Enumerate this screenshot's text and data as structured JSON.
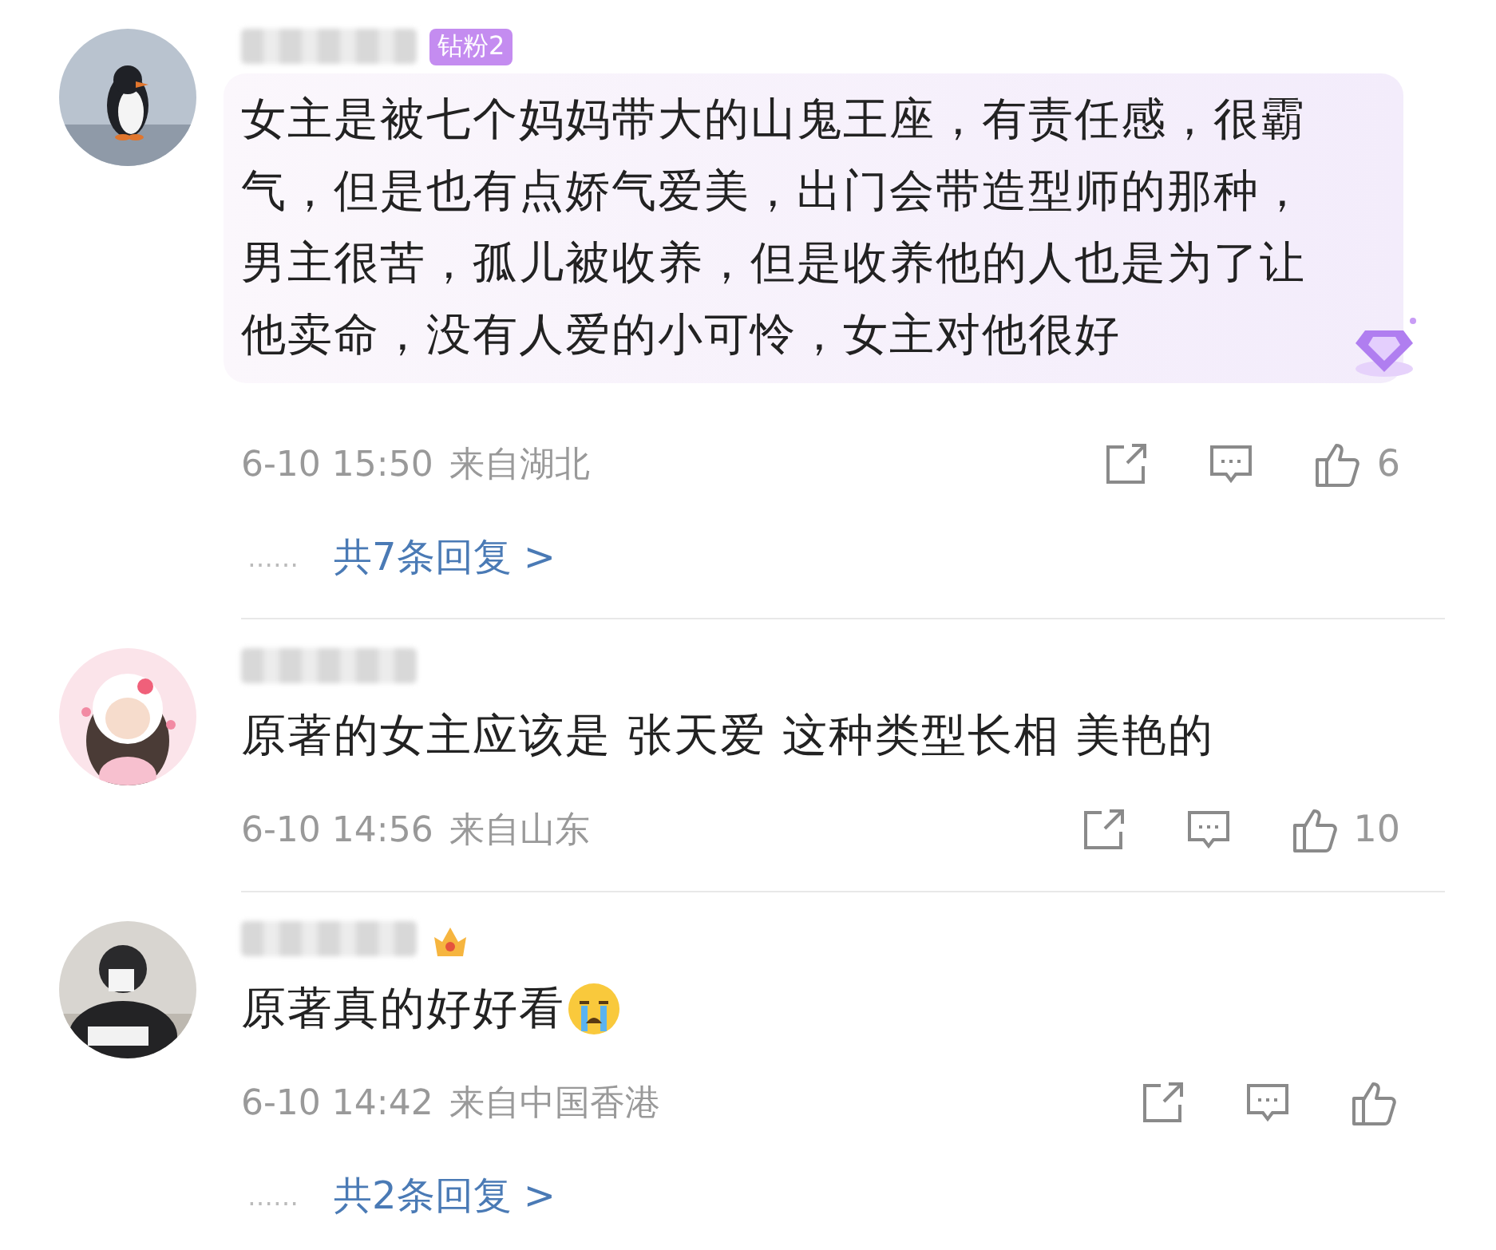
{
  "comments": [
    {
      "badge": "钻粉2",
      "text": "女主是被七个妈妈带大的山鬼王座，有责任感，很霸气，但是也有点娇气爱美，出门会带造型师的那种，男主很苦，孤儿被收养，但是收养他的人也是为了让他卖命，没有人爱的小可怜，女主对他很好",
      "highlighted": true,
      "time": "6-10 15:50",
      "location": "来自湖北",
      "likes": "6",
      "reply_dots": "……",
      "replies": "共7条回复 >"
    },
    {
      "text": "原著的女主应该是 张天爱 这种类型长相 美艳的",
      "time": "6-10 14:56",
      "location": "来自山东",
      "likes": "10"
    },
    {
      "vip": true,
      "text": "原著真的好好看",
      "crying_emoji": true,
      "time": "6-10 14:42",
      "location": "来自中国香港",
      "reply_dots": "……",
      "replies": "共2条回复 >"
    }
  ]
}
